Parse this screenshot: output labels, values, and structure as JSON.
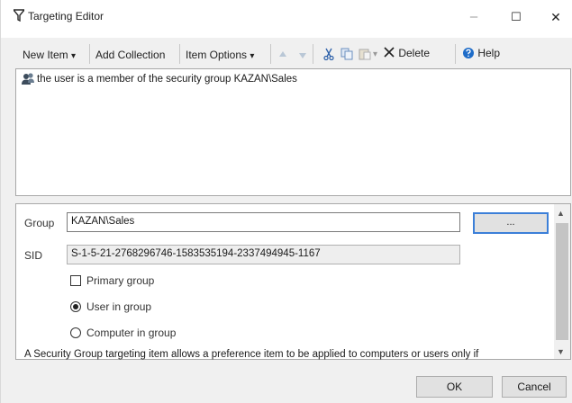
{
  "window": {
    "title": "Targeting Editor",
    "controls": {
      "minimize": "–",
      "maximize": "☐",
      "close": "✕"
    }
  },
  "toolbar": {
    "new_item": "New Item",
    "add_collection": "Add Collection",
    "item_options": "Item Options",
    "delete": "Delete",
    "help": "Help",
    "dropdown_glyph": "▾"
  },
  "tree": {
    "items": [
      {
        "text": "the user is a member of the security group KAZAN\\Sales",
        "icon": "security-group-icon"
      }
    ]
  },
  "properties": {
    "group_label": "Group",
    "group_value": "KAZAN\\Sales",
    "browse_label": "...",
    "sid_label": "SID",
    "sid_value": "S-1-5-21-2768296746-1583535194-2337494945-1167",
    "primary_group_label": "Primary group",
    "primary_group_checked": false,
    "user_in_group_label": "User in group",
    "computer_in_group_label": "Computer in group",
    "selected_option": "user_in_group",
    "description": "A Security Group targeting item allows a preference item to be applied to computers or users only if"
  },
  "buttons": {
    "ok": "OK",
    "cancel": "Cancel"
  },
  "colors": {
    "accent": "#3c7fd8",
    "help_icon": "#1e6cc8",
    "funnel": "#2b2b2b"
  }
}
